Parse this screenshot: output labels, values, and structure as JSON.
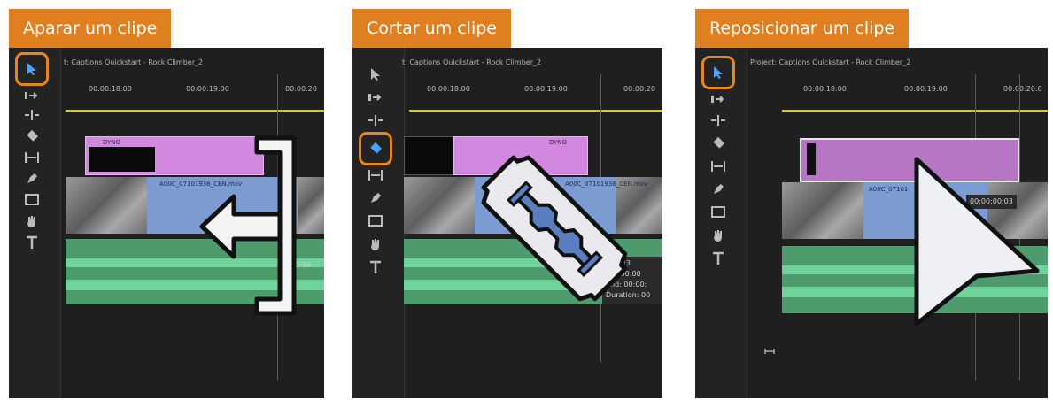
{
  "panels": [
    {
      "title": "Aparar um clipe",
      "sequence_header": "t: Captions Quickstart - Rock Climber_2",
      "timecodes": [
        "00:00:18:00",
        "00:00:19:00",
        "00:00:20"
      ],
      "clip_pink_label": "DYNO",
      "clip_video_label": "A00C_07101936_CEN.mov",
      "readout": "00:00"
    },
    {
      "title": "Cortar um clipe",
      "sequence_header": "t: Captions Quickstart - Rock Climber_2",
      "timecodes": [
        "00:00:18:00",
        "00:00:19:00",
        "00:00:20"
      ],
      "clip_pink_label": "DYNO",
      "clip_video_label": "A00C_07101936_CEN.mov",
      "readout_lines": [
        "...0723",
        "art: 00:00",
        "End: 00:00:",
        "Duration: 00"
      ]
    },
    {
      "title": "Reposicionar um clipe",
      "sequence_header": "Project: Captions Quickstart - Rock Climber_2",
      "timecodes": [
        "00:00:18:00",
        "00:00:19:00",
        "00:00:20:0"
      ],
      "clip_video_label": "A00C_07101",
      "drag_readout": "00:00:00:03"
    }
  ],
  "tools": [
    "selection-tool",
    "track-select-tool",
    "ripple-edit-tool",
    "razor-tool",
    "slip-tool",
    "pen-tool",
    "rectangle-tool",
    "hand-tool",
    "type-tool"
  ],
  "colors": {
    "accent": "#e07f1f",
    "pink_clip": "#d388e0",
    "video_clip": "#7c9bd1",
    "audio_clip": "#4e9b6e"
  }
}
